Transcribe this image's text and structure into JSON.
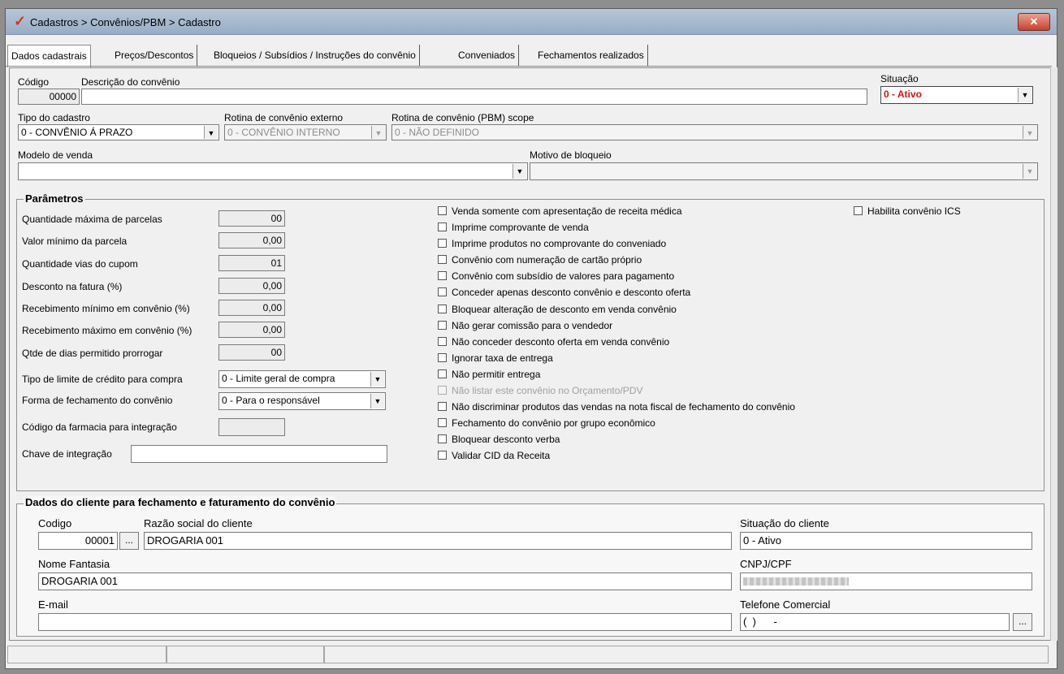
{
  "window": {
    "title": "Cadastros > Convênios/PBM > Cadastro",
    "close_label": "✕"
  },
  "tabs": [
    {
      "label": "Dados cadastrais"
    },
    {
      "label": "Preços/Descontos"
    },
    {
      "label": "Bloqueios / Subsídios / Instruções do convênio"
    },
    {
      "label": "Conveniados"
    },
    {
      "label": "Fechamentos realizados"
    }
  ],
  "header": {
    "codigo_label": "Código",
    "codigo_value": "00000",
    "descricao_label": "Descrição do convênio",
    "descricao_value": "",
    "situacao_label": "Situação",
    "situacao_value": "0 - Ativo",
    "tipo_label": "Tipo do cadastro",
    "tipo_value": "0 - CONVÊNIO Á PRAZO",
    "rotina_ext_label": "Rotina de convênio externo",
    "rotina_ext_value": "0 - CONVÊNIO INTERNO",
    "rotina_pbm_label": "Rotina de convênio (PBM) scope",
    "rotina_pbm_value": "0 - NÃO DEFINIDO",
    "modelo_label": "Modelo de venda",
    "modelo_value": "",
    "motivo_label": "Motivo de bloqueio",
    "motivo_value": ""
  },
  "parametros": {
    "title": "Parâmetros",
    "fields": [
      {
        "label": "Quantidade máxima de parcelas",
        "value": "00"
      },
      {
        "label": "Valor mínimo da parcela",
        "value": "0,00"
      },
      {
        "label": "Quantidade vias do cupom",
        "value": "01"
      },
      {
        "label": "Desconto na fatura (%)",
        "value": "0,00"
      },
      {
        "label": "Recebimento mínimo em convênio (%)",
        "value": "0,00"
      },
      {
        "label": "Recebimento máximo em convênio (%)",
        "value": "0,00"
      },
      {
        "label": "Qtde de dias permitido prorrogar",
        "value": "00"
      }
    ],
    "limite_label": "Tipo de limite de crédito para compra",
    "limite_value": "0 - Limite geral de compra",
    "fechamento_label": "Forma de fechamento do convênio",
    "fechamento_value": "0 - Para o responsável",
    "farmacia_label": "Código da farmacia para integração",
    "farmacia_value": "",
    "chave_label": "Chave de integração",
    "chave_value": "",
    "checkboxes": [
      {
        "label": "Venda somente com apresentação de receita médica"
      },
      {
        "label": "Imprime comprovante de venda"
      },
      {
        "label": "Imprime produtos no comprovante do conveniado"
      },
      {
        "label": "Convênio com numeração de cartão próprio"
      },
      {
        "label": "Convênio com subsídio de valores para pagamento"
      },
      {
        "label": "Conceder apenas desconto convênio e desconto oferta"
      },
      {
        "label": "Bloquear alteração de desconto em venda convênio"
      },
      {
        "label": "Não gerar comissão para o vendedor"
      },
      {
        "label": "Não conceder desconto oferta em venda convênio"
      },
      {
        "label": "Ignorar taxa de entrega"
      },
      {
        "label": "Não permitir entrega"
      },
      {
        "label": "Não listar este convênio no Orçamento/PDV"
      },
      {
        "label": "Não discriminar produtos das vendas na nota fiscal de fechamento do convênio"
      },
      {
        "label": "Fechamento do convênio por grupo econômico"
      },
      {
        "label": "Bloquear desconto verba"
      },
      {
        "label": "Validar CID da Receita"
      }
    ],
    "ics_label": "Habilita convênio ICS"
  },
  "cliente": {
    "title": "Dados do cliente para fechamento e faturamento do convênio",
    "codigo_label": "Codigo",
    "codigo_value": "00001",
    "dots_label": "...",
    "razao_label": "Razão social do cliente",
    "razao_value": "DROGARIA 001",
    "situacao_label": "Situação do cliente",
    "situacao_value": "0 - Ativo",
    "fantasia_label": "Nome Fantasia",
    "fantasia_value": "DROGARIA 001",
    "cnpj_label": "CNPJ/CPF",
    "email_label": "E-mail",
    "email_value": "",
    "telefone_label": "Telefone Comercial",
    "telefone_value": "(  )      -"
  },
  "icons": {
    "app": "check-logo-icon",
    "dropdown": "chevron-down-icon",
    "close": "close-icon"
  },
  "colors": {
    "situacao_text": "#e01010",
    "titlebar": "#a9bbd0",
    "close_button": "#c7432c"
  }
}
